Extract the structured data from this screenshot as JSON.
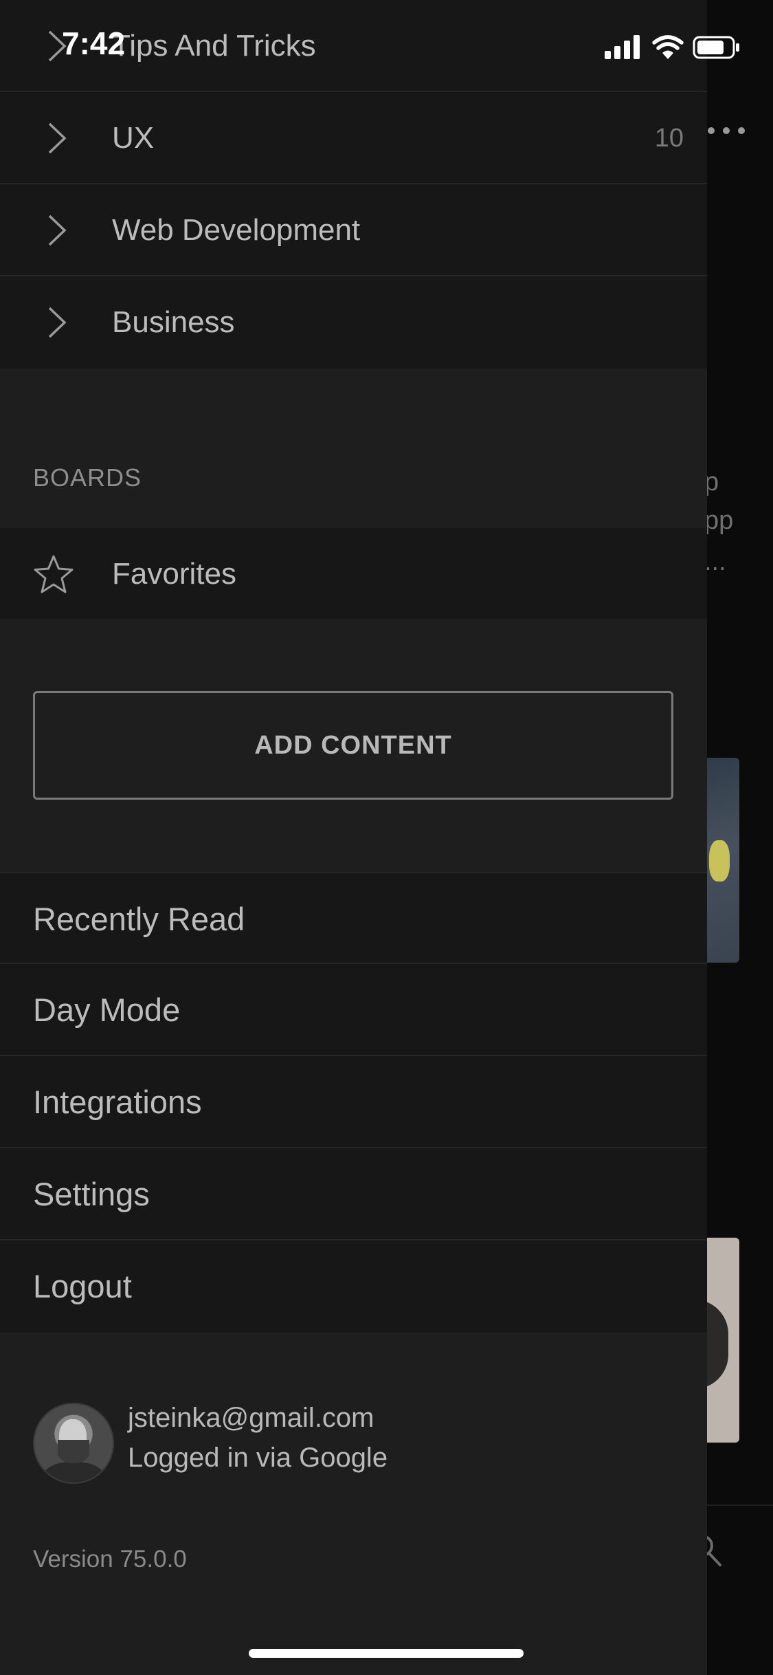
{
  "status_bar": {
    "time": "7:42"
  },
  "background": {
    "more_icon": "more-dots-icon",
    "text_fragments": [
      "p",
      "pp",
      "..."
    ]
  },
  "categories": [
    {
      "label": "Tips And Tricks",
      "count": ""
    },
    {
      "label": "UX",
      "count": "10"
    },
    {
      "label": "Web Development",
      "count": ""
    },
    {
      "label": "Business",
      "count": ""
    }
  ],
  "boards": {
    "title": "BOARDS",
    "favorites_label": "Favorites"
  },
  "add_content_label": "ADD CONTENT",
  "menu": [
    {
      "label": "Recently Read"
    },
    {
      "label": "Day Mode"
    },
    {
      "label": "Integrations"
    },
    {
      "label": "Settings"
    },
    {
      "label": "Logout"
    }
  ],
  "profile": {
    "email": "jsteinka@gmail.com",
    "login_method": "Logged in via Google"
  },
  "version": "Version 75.0.0",
  "colors": {
    "drawer_bg": "#1e1e1e",
    "row_bg": "#171717",
    "text": "#bcbcbc",
    "muted": "#8e8e8e"
  }
}
